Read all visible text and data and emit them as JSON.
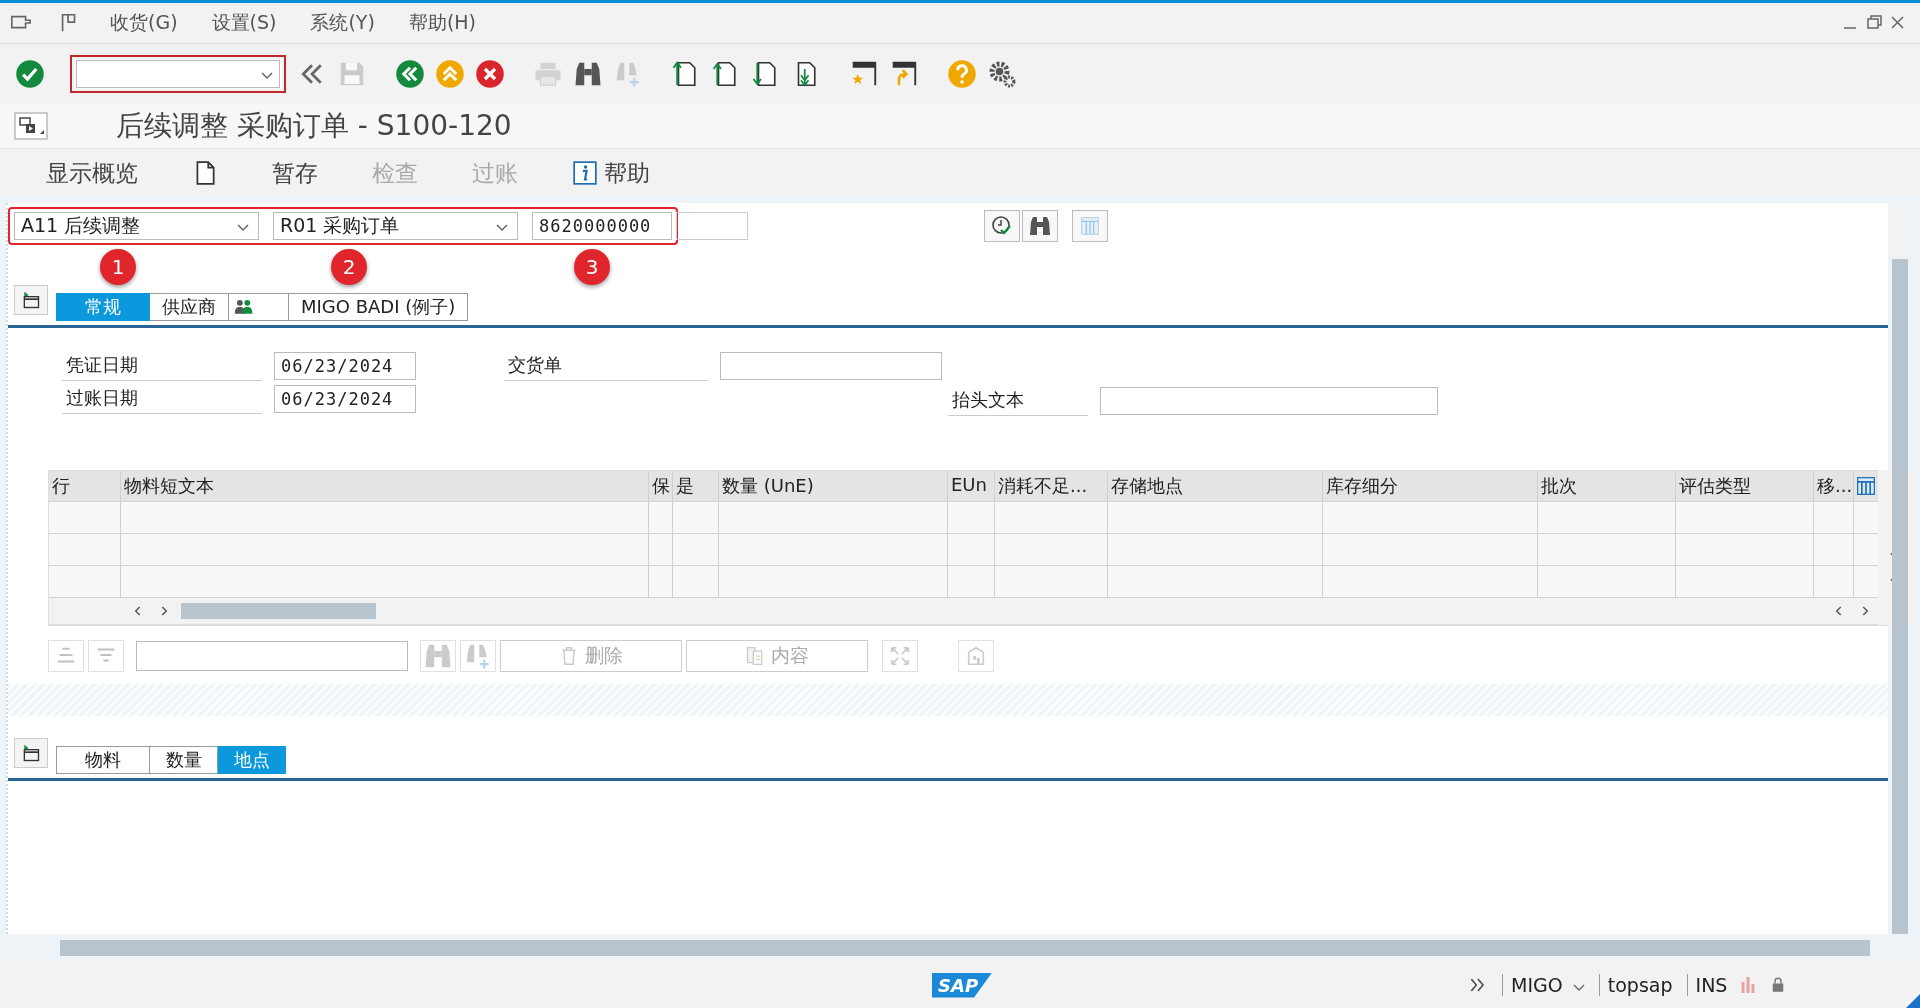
{
  "menu_bar": [
    {
      "label": "收货(G)"
    },
    {
      "label": "设置(S)"
    },
    {
      "label": "系统(Y)"
    },
    {
      "label": "帮助(H)"
    }
  ],
  "toolbar": [
    {
      "kind": "enter",
      "disabled": false
    },
    {
      "kind": "command"
    },
    {
      "kind": "collapse",
      "disabled": false
    },
    {
      "kind": "save",
      "disabled": true
    },
    {
      "kind": "back",
      "disabled": false
    },
    {
      "kind": "exit",
      "disabled": false
    },
    {
      "kind": "cancel",
      "disabled": false
    },
    {
      "kind": "print",
      "disabled": true
    },
    {
      "kind": "find",
      "disabled": false
    },
    {
      "kind": "findnext",
      "disabled": true
    },
    {
      "kind": "first",
      "disabled": false
    },
    {
      "kind": "prev",
      "disabled": false
    },
    {
      "kind": "next",
      "disabled": false
    },
    {
      "kind": "last",
      "disabled": false
    },
    {
      "kind": "session",
      "disabled": false
    },
    {
      "kind": "shortcut",
      "disabled": false
    },
    {
      "kind": "help",
      "disabled": false
    },
    {
      "kind": "settings",
      "disabled": false
    }
  ],
  "window": {
    "title": "后续调整 采购订单 - S100-120"
  },
  "app_toolbar": [
    {
      "kind": "text",
      "label": "显示概览",
      "disabled": false
    },
    {
      "kind": "document"
    },
    {
      "kind": "text",
      "label": "暂存",
      "disabled": false
    },
    {
      "kind": "text",
      "label": "检查",
      "disabled": true
    },
    {
      "kind": "text",
      "label": "过账",
      "disabled": true
    },
    {
      "kind": "info",
      "label": "帮助",
      "disabled": false
    }
  ],
  "selection": {
    "action": "A11 后续调整",
    "reference": "R01 采购订单",
    "document_number": "8620000000",
    "highlighted": true
  },
  "annotations": [
    {
      "number": "1"
    },
    {
      "number": "2"
    },
    {
      "number": "3"
    }
  ],
  "header_tabs": [
    {
      "kind": "text",
      "label": "常规",
      "selected": true
    },
    {
      "kind": "text",
      "label": "供应商",
      "selected": false
    },
    {
      "kind": "partners",
      "selected": false
    },
    {
      "kind": "text",
      "label": "MIGO BADI (例子)",
      "selected": false
    }
  ],
  "header_fields": [
    {
      "label": "凭证日期",
      "value": "06/23/2024"
    },
    {
      "label": "过账日期",
      "value": "06/23/2024"
    },
    {
      "label": "交货单"
    },
    {
      "label": "抬头文本"
    }
  ],
  "table": {
    "columns": [
      "行",
      "物料短文本",
      "保",
      "是",
      "数量 (UnE)",
      "EUn",
      "消耗不足...",
      "存储地点",
      "库存细分",
      "批次",
      "评估类型",
      "移..."
    ]
  },
  "table_toolbar": [
    {
      "kind": "sort-asc",
      "disabled": true
    },
    {
      "kind": "filter",
      "disabled": true
    },
    {
      "kind": "field"
    },
    {
      "kind": "find",
      "disabled": true
    },
    {
      "kind": "findnext",
      "disabled": true
    },
    {
      "kind": "delete",
      "label": "删除",
      "disabled": true
    },
    {
      "kind": "content",
      "label": "内容",
      "disabled": true
    },
    {
      "kind": "expand",
      "disabled": true
    },
    {
      "kind": "export",
      "disabled": true
    }
  ],
  "detail_tabs": [
    {
      "label": "物料",
      "selected": false
    },
    {
      "label": "数量",
      "selected": false
    },
    {
      "label": "地点",
      "selected": true
    }
  ],
  "status_bar": {
    "logo": "SAP",
    "transaction": "MIGO",
    "server": "topsap",
    "mode": "INS"
  }
}
